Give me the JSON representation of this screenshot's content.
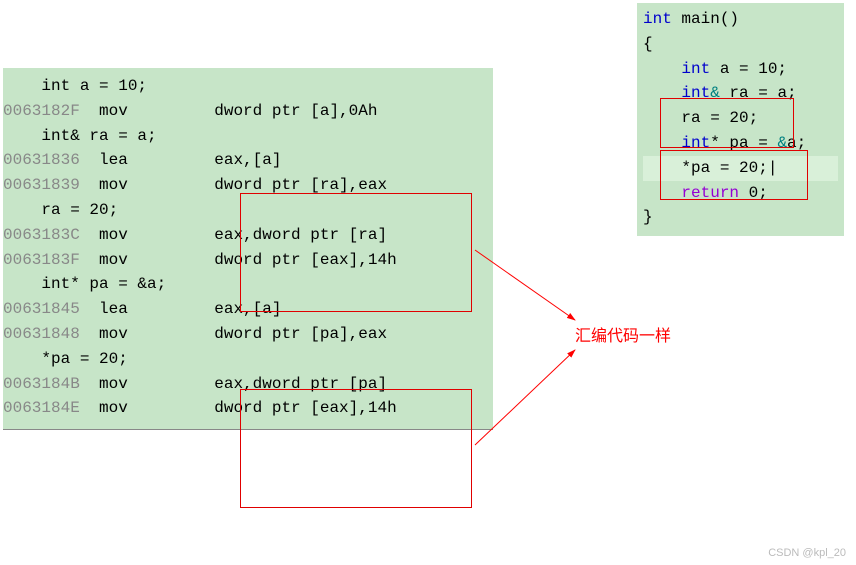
{
  "left": {
    "l1": "    int a = 10;",
    "l2a": "0063182F",
    "l2b": "  mov         dword ptr [a],0Ah",
    "blank1": "",
    "l3": "    int& ra = a;",
    "l4a": "00631836",
    "l4b": "  lea         eax,[a]",
    "l5a": "00631839",
    "l5b": "  mov         dword ptr [ra],eax",
    "l6": "    ra = 20;",
    "l7a": "0063183C",
    "l7b": "  mov         eax,dword ptr [ra]",
    "l8a": "0063183F",
    "l8b": "  mov         dword ptr [eax],14h",
    "blank2": "",
    "l9": "    int* pa = &a;",
    "l10a": "00631845",
    "l10b": "  lea         eax,[a]",
    "l11a": "00631848",
    "l11b": "  mov         dword ptr [pa],eax",
    "l12": "    *pa = 20;",
    "l13a": "0063184B",
    "l13b": "  mov         eax,dword ptr [pa]",
    "l14a": "0063184E",
    "l14b": "  mov         dword ptr [eax],14h"
  },
  "right": {
    "r1_kw": "int",
    "r1_rest": " main()",
    "r2": "{",
    "r3_kw": "int",
    "r3_rest": " a = 10;",
    "r4_kw": "int",
    "r4_amp": "&",
    "r4_rest": " ra = a;",
    "r5": "ra = 20;",
    "r6_kw": "int",
    "r6_star": "*",
    "r6_rest": " pa = ",
    "r6_amp": "&",
    "r6_rest2": "a;",
    "r7_star": "*",
    "r7_rest": "pa = 20;",
    "r8_kw": "return",
    "r8_rest": " 0;",
    "r9": "}"
  },
  "annotation": "汇编代码一样",
  "watermark": "CSDN @kpl_20"
}
